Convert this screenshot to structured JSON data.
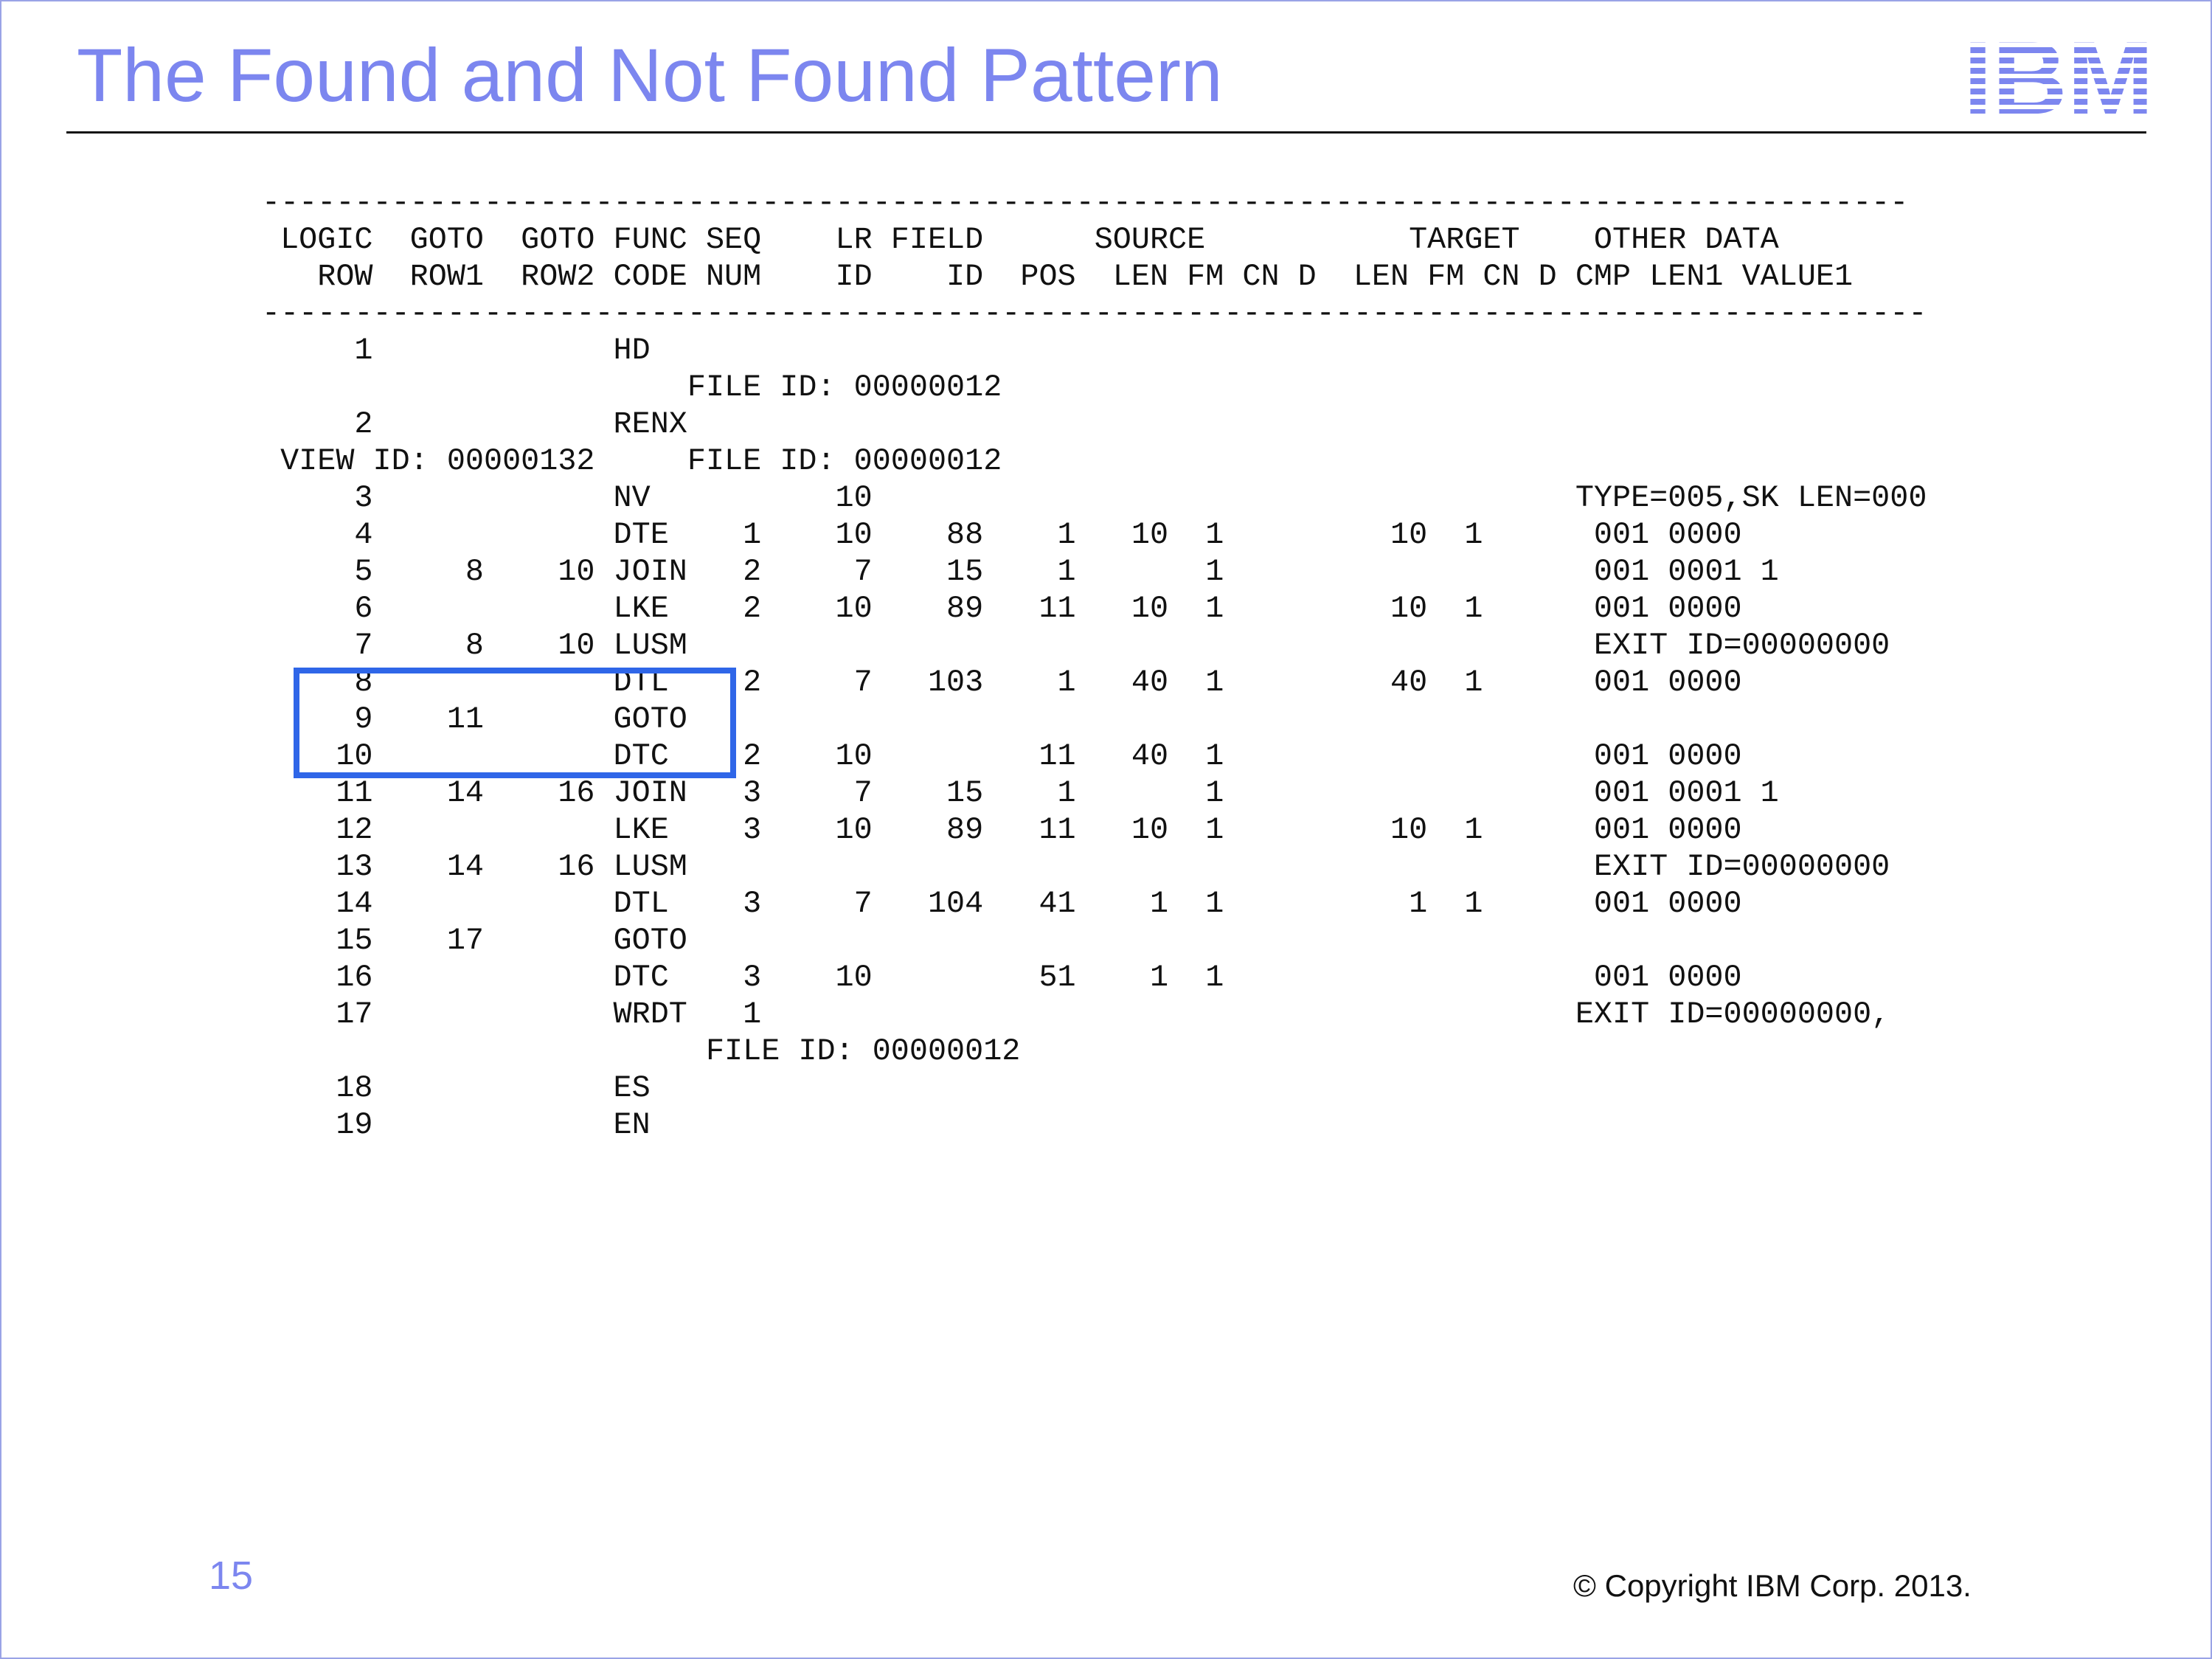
{
  "slide": {
    "title": "The Found and Not Found Pattern",
    "page_number": "15",
    "copyright": "© Copyright IBM Corp. 2013.",
    "logo_text": "IBM",
    "colors": {
      "title": "#7c86ef",
      "logo": "#7c86ef",
      "highlight_box": "#2f66e8",
      "text": "#111111"
    }
  },
  "listing": {
    "lines": [
      "-----------------------------------------------------------------------------------------",
      " LOGIC  GOTO  GOTO FUNC SEQ    LR FIELD      SOURCE           TARGET    OTHER DATA",
      "   ROW  ROW1  ROW2 CODE NUM    ID    ID  POS  LEN FM CN D  LEN FM CN D CMP LEN1 VALUE1",
      "------------------------------------------------------------------------------------------",
      "     1             HD",
      "                       FILE ID: 00000012",
      "     2             RENX",
      " VIEW ID: 00000132     FILE ID: 00000012",
      "     3             NV          10                                      TYPE=005,SK LEN=000",
      "     4             DTE    1    10    88    1   10  1         10  1      001 0000",
      "     5     8    10 JOIN   2     7    15    1       1                    001 0001 1",
      "     6             LKE    2    10    89   11   10  1         10  1      001 0000",
      "     7     8    10 LUSM                                                 EXIT ID=00000000",
      "     8             DTL    2     7   103    1   40  1         40  1      001 0000",
      "     9    11       GOTO",
      "    10             DTC    2    10         11   40  1                    001 0000",
      "    11    14    16 JOIN   3     7    15    1       1                    001 0001 1",
      "    12             LKE    3    10    89   11   10  1         10  1      001 0000",
      "    13    14    16 LUSM                                                 EXIT ID=00000000",
      "    14             DTL    3     7   104   41    1  1          1  1      001 0000",
      "    15    17       GOTO",
      "    16             DTC    3    10         51    1  1                    001 0000",
      "    17             WRDT   1                                            EXIT ID=00000000,",
      "                        FILE ID: 00000012",
      "    18             ES",
      "    19             EN"
    ]
  }
}
